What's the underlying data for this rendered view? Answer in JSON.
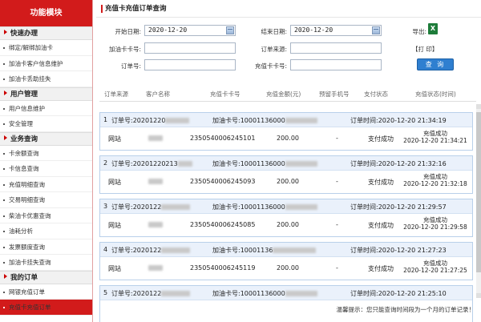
{
  "sidebar": {
    "title": "功能模块",
    "groups": [
      {
        "name": "快速办理",
        "items": [
          "绑定/解绑加油卡",
          "加油卡客户信息维护",
          "加油卡丢助挂失"
        ]
      },
      {
        "name": "用户管理",
        "items": [
          "用户信息维护",
          "安全管理"
        ]
      },
      {
        "name": "业务查询",
        "items": [
          "卡余额查询",
          "卡信息查询",
          "充值明细查询",
          "交易明细查询",
          "柴油卡优惠查询",
          "油耗分析",
          "发票额度查询",
          "加油卡挂失查询"
        ]
      },
      {
        "name": "我的订单",
        "items": [
          "网银充值订单",
          "充值卡充值订单"
        ]
      }
    ],
    "active": "充值卡充值订单"
  },
  "page": {
    "title": "充值卡充值订单查询"
  },
  "form": {
    "start_date_label": "开始日期:",
    "start_date_value": "2020-12-20",
    "end_date_label": "结束日期:",
    "end_date_value": "2020-12-20",
    "export_label": "导出:",
    "export_icon": "excel-icon",
    "fuel_card_label": "加油卡卡号:",
    "order_source_label": "订单来源:",
    "print_label": "【打 印】",
    "order_no_label": "订单号:",
    "recharge_card_label": "充值卡卡号:",
    "query_button": "查 询"
  },
  "table": {
    "columns": [
      "订单来源",
      "客户名称",
      "充值卡卡号",
      "充值金额(元)",
      "预留手机号",
      "支付状态",
      "充值状态(时间)"
    ]
  },
  "orders": [
    {
      "index": "1",
      "order_no_label": "订单号:",
      "order_no": "20201220",
      "fuel_card_label": "加油卡号:",
      "fuel_card": "10001136000",
      "order_time_label": "订单时间:",
      "order_time": "2020-12-20 21:34:19",
      "source": "网站",
      "recharge_card": "2350540006245101",
      "amount": "200.00",
      "phone": "-",
      "pay_status": "支付成功",
      "recharge_status": "充值成功",
      "recharge_time": "2020-12-20 21:34:21"
    },
    {
      "index": "2",
      "order_no_label": "订单号:",
      "order_no": "20201220213",
      "fuel_card_label": "加油卡号:",
      "fuel_card": "10001136000",
      "order_time_label": "订单时间:",
      "order_time": "2020-12-20 21:32:16",
      "source": "网站",
      "recharge_card": "2350540006245093",
      "amount": "200.00",
      "phone": "-",
      "pay_status": "支付成功",
      "recharge_status": "充值成功",
      "recharge_time": "2020-12-20 21:32:18"
    },
    {
      "index": "3",
      "order_no_label": "订单号:",
      "order_no": "2020122",
      "fuel_card_label": "加油卡号:",
      "fuel_card": "10001136000",
      "order_time_label": "订单时间:",
      "order_time": "2020-12-20 21:29:57",
      "source": "网站",
      "recharge_card": "2350540006245085",
      "amount": "200.00",
      "phone": "-",
      "pay_status": "支付成功",
      "recharge_status": "充值成功",
      "recharge_time": "2020-12-20 21:29:58"
    },
    {
      "index": "4",
      "order_no_label": "订单号:",
      "order_no": "2020122",
      "fuel_card_label": "加油卡号:",
      "fuel_card": "10001136",
      "order_time_label": "订单时间:",
      "order_time": "2020-12-20 21:27:23",
      "source": "网站",
      "recharge_card": "2350540006245119",
      "amount": "200.00",
      "phone": "-",
      "pay_status": "支付成功",
      "recharge_status": "充值成功",
      "recharge_time": "2020-12-20 21:27:25"
    },
    {
      "index": "5",
      "order_no_label": "订单号:",
      "order_no": "2020122",
      "fuel_card_label": "加油卡号:",
      "fuel_card": "10001136000",
      "order_time_label": "订单时间:",
      "order_time": "2020-12-20 21:25:10",
      "source": "",
      "recharge_card": "",
      "amount": "",
      "phone": "",
      "pay_status": "",
      "recharge_status": "",
      "recharge_time": ""
    }
  ],
  "tip": {
    "text": "温馨提示：您只能查询时间段为一个月的订单记录！"
  }
}
